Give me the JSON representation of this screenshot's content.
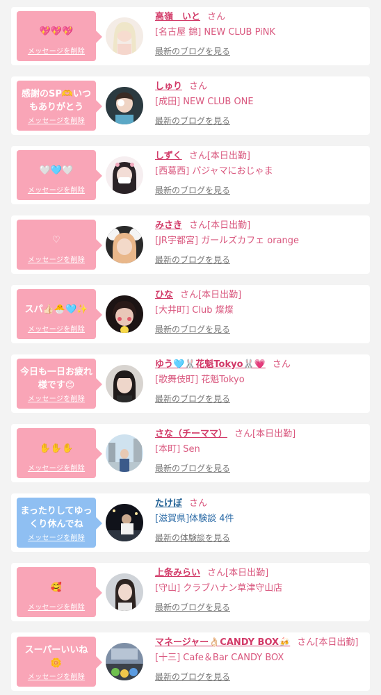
{
  "delete_label": "メッセージを削除",
  "blog_label": "最新のブログを見る",
  "review_label": "最新の体験談を見る",
  "colors": {
    "pink_bubble": "#f9a5b7",
    "blue_bubble": "#8fbff2",
    "name_pink": "#d23a68",
    "name_blue": "#1f5f93"
  },
  "messages": [
    {
      "bubble_text": "💖💖💖",
      "name": "高嶺　いと",
      "honorific": "さん",
      "status": "",
      "shop": "[名古屋 錦] NEW CLUB PiNK",
      "link": "最新のブログを見る",
      "kind": "cast"
    },
    {
      "bubble_text": "感謝のSP🫶いつもありがとう",
      "name": "しゅり",
      "honorific": "さん",
      "status": "",
      "shop": "[成田] NEW CLUB ONE",
      "link": "最新のブログを見る",
      "kind": "cast"
    },
    {
      "bubble_text": "🤍🩵🤍",
      "name": "しずく",
      "honorific": "さん",
      "status": "[本日出勤]",
      "shop": "[西葛西] パジャマにおじゃま",
      "link": "最新のブログを見る",
      "kind": "cast"
    },
    {
      "bubble_text": "♡",
      "name": "みさき",
      "honorific": "さん",
      "status": "[本日出勤]",
      "shop": "[JR宇都宮] ガールズカフェ orange",
      "link": "最新のブログを見る",
      "kind": "cast"
    },
    {
      "bubble_text": "スパ👍🏻🐣🩵✨",
      "name": "ひな",
      "honorific": "さん",
      "status": "[本日出勤]",
      "shop": "[大井町] Club 燦燦",
      "link": "最新のブログを見る",
      "kind": "cast"
    },
    {
      "bubble_text": "今日も一日お疲れ様です😊",
      "name": "ゆう🩵🐰花魁Tokyo🐰💗",
      "honorific": "さん",
      "status": "",
      "shop": "[歌舞伎町] 花魁Tokyo",
      "link": "最新のブログを見る",
      "kind": "cast"
    },
    {
      "bubble_text": "✋✋✋",
      "name": "さな（チーママ）",
      "honorific": "さん",
      "status": "[本日出勤]",
      "shop": "[本町] Sen",
      "link": "最新のブログを見る",
      "kind": "cast"
    },
    {
      "bubble_text": "まったりしてゆっくり休んでね",
      "name": "たけぼ",
      "honorific": "さん",
      "status": "",
      "shop": "[滋賀県]体験談 4件",
      "link": "最新の体験談を見る",
      "kind": "user"
    },
    {
      "bubble_text": "🥰",
      "name": "上条みらい",
      "honorific": "さん",
      "status": "[本日出勤]",
      "shop": "[守山] クラブハナン草津守山店",
      "link": "最新のブログを見る",
      "kind": "cast"
    },
    {
      "bubble_text": "スーパーいいね🌼",
      "name": "マネージャー👌🏻CANDY BOX🍻",
      "honorific": "さん",
      "status": "[本日出勤]",
      "shop": "[十三] Cafe＆Bar CANDY BOX",
      "link": "最新のブログを見る",
      "kind": "cast"
    }
  ]
}
